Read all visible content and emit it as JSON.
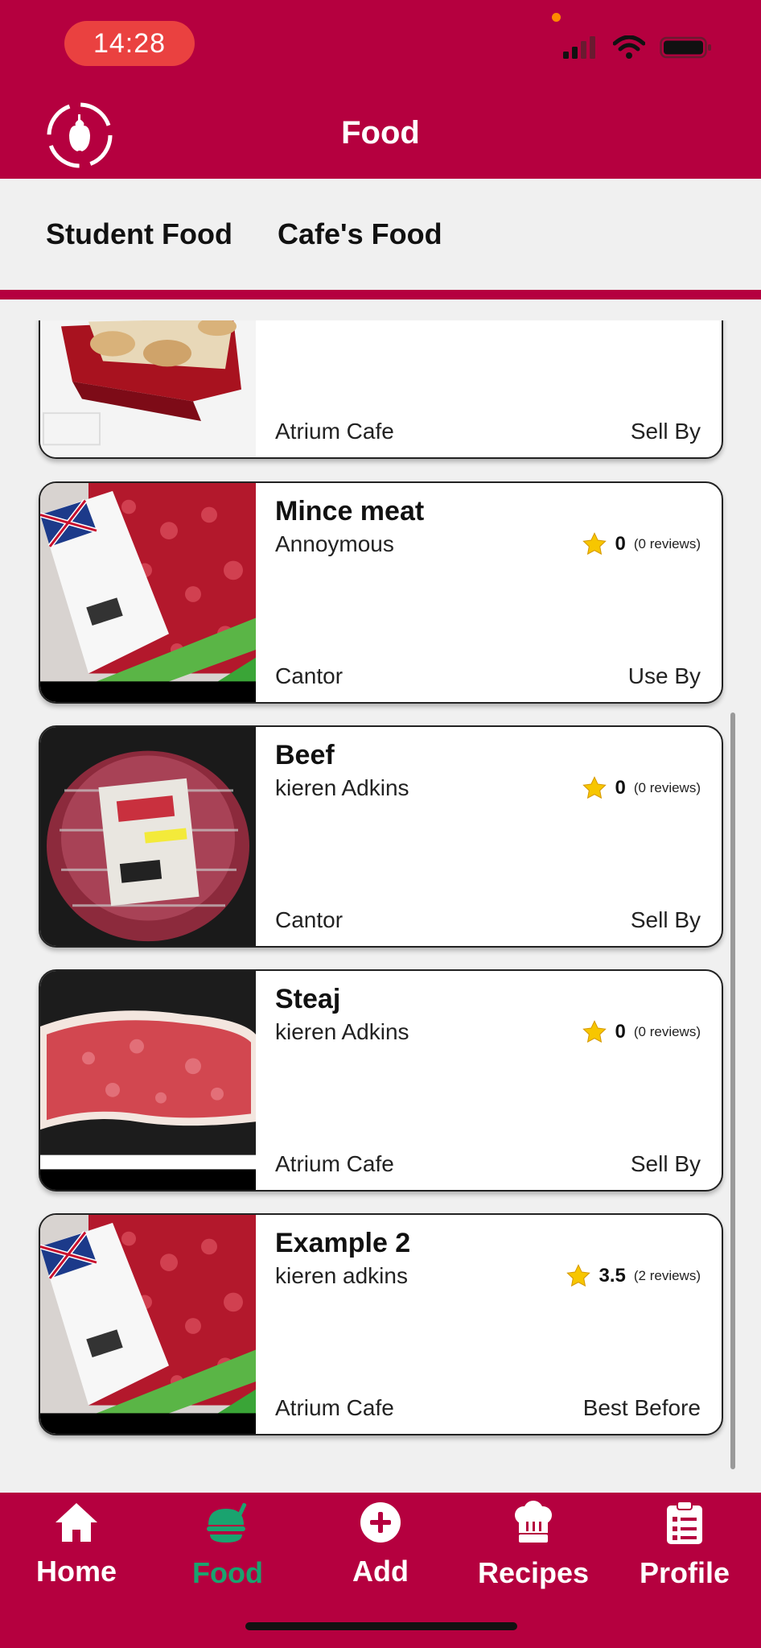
{
  "status_bar": {
    "time": "14:28"
  },
  "header": {
    "title": "Food"
  },
  "tabs": [
    {
      "label": "Student Food"
    },
    {
      "label": "Cafe's Food"
    }
  ],
  "items": [
    {
      "name": "",
      "owner": "",
      "location": "Atrium Cafe",
      "date_type": "Sell By",
      "thumb": "mince-pies-image"
    },
    {
      "name": "Mince meat",
      "owner": "Annoymous",
      "rating": "0",
      "reviews": "(0 reviews)",
      "location": "Cantor",
      "date_type": "Use By",
      "thumb": "mince-meat-image"
    },
    {
      "name": "Beef",
      "owner": "kieren Adkins",
      "rating": "0",
      "reviews": "(0 reviews)",
      "location": "Cantor",
      "date_type": "Sell By",
      "thumb": "beef-joint-image"
    },
    {
      "name": "Steaj",
      "owner": "kieren Adkins",
      "rating": "0",
      "reviews": "(0 reviews)",
      "location": "Atrium Cafe",
      "date_type": "Sell By",
      "thumb": "steak-image"
    },
    {
      "name": "Example 2",
      "owner": "kieren adkins",
      "rating": "3.5",
      "reviews": "(2 reviews)",
      "location": "Atrium Cafe",
      "date_type": "Best Before",
      "thumb": "mince-meat-image"
    }
  ],
  "nav": [
    {
      "label": "Home",
      "icon": "home-icon"
    },
    {
      "label": "Food",
      "icon": "food-icon",
      "active": true
    },
    {
      "label": "Add",
      "icon": "add-circle-icon"
    },
    {
      "label": "Recipes",
      "icon": "chef-hat-icon"
    },
    {
      "label": "Profile",
      "icon": "clipboard-icon"
    }
  ],
  "colors": {
    "brand": "#b5003f",
    "active_nav": "#1aa36f",
    "time_pill": "#ea4140"
  }
}
